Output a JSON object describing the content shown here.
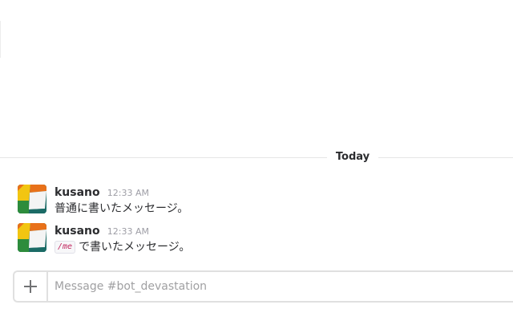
{
  "divider": {
    "label": "Today"
  },
  "messages": [
    {
      "author": "kusano",
      "time": "12:33 AM",
      "text": "普通に書いたメッセージ。"
    },
    {
      "author": "kusano",
      "time": "12:33 AM",
      "code": "/me",
      "text": "で書いたメッセージ。"
    }
  ],
  "composer": {
    "placeholder": "Message #bot_devastation",
    "value": "",
    "attach_icon": "plus-icon"
  },
  "colors": {
    "avatar_orange": "#e8711a",
    "avatar_yellow": "#f2c511",
    "avatar_green": "#2d8c3c",
    "avatar_teal": "#1b6b66",
    "avatar_white": "#f4f4f4",
    "code_text": "#c0245c"
  }
}
